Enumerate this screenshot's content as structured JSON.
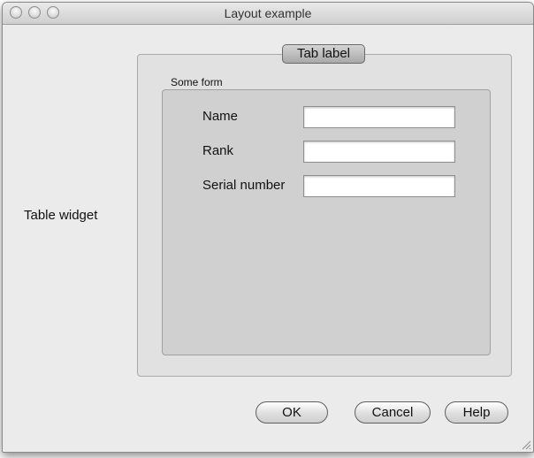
{
  "window": {
    "title": "Layout example"
  },
  "left_panel": {
    "table_widget_label": "Table widget"
  },
  "tabs": [
    {
      "label": "Tab label"
    }
  ],
  "form_group": {
    "title": "Some form",
    "fields": [
      {
        "label": "Name",
        "value": ""
      },
      {
        "label": "Rank",
        "value": ""
      },
      {
        "label": "Serial number",
        "value": ""
      }
    ]
  },
  "buttons": {
    "ok": "OK",
    "cancel": "Cancel",
    "help": "Help"
  }
}
